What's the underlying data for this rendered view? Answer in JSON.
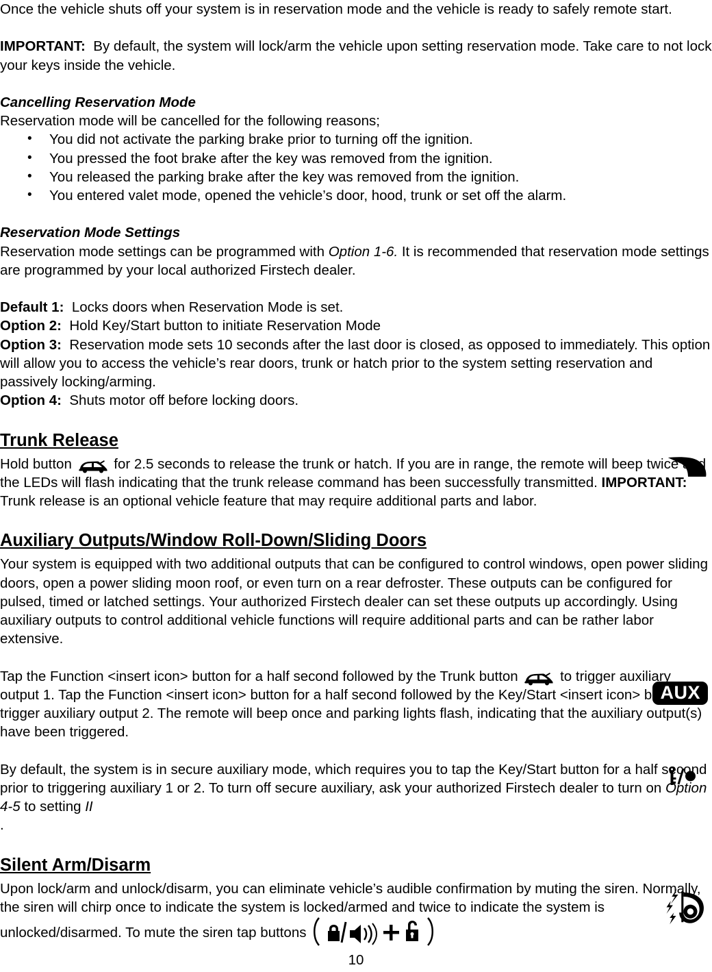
{
  "document": {
    "page_number": "10"
  },
  "intro": {
    "paragraph": "Once the vehicle shuts off your system is in reservation mode and the vehicle is ready to safely remote start.",
    "important_label": "IMPORTANT:",
    "important_text": "By default, the system will lock/arm the vehicle upon setting reservation mode. Take care to not lock your keys inside the vehicle."
  },
  "cancelling": {
    "heading": "Cancelling Reservation Mode",
    "lead_in": "Reservation mode will be cancelled for the following reasons;",
    "reasons": [
      "You did not activate the parking brake prior to turning off the ignition.",
      "You pressed the foot brake after the key was removed from the ignition.",
      "You released the parking brake after the key was removed from the ignition.",
      "You entered valet mode, opened the vehicle’s door, hood, trunk or set off the alarm."
    ]
  },
  "settings": {
    "heading": "Reservation Mode Settings",
    "intro_part1": "Reservation mode settings can be programmed with ",
    "intro_option": "Option 1-6.",
    "intro_part2": "  It is recommended that reservation mode settings are programmed by your local authorized Firstech dealer.",
    "options": [
      {
        "label": "Default 1:",
        "text": "Locks doors when Reservation Mode is set."
      },
      {
        "label": "Option 2:",
        "text": "Hold Key/Start button to initiate Reservation Mode"
      },
      {
        "label": "Option 3:",
        "text": "Reservation mode sets 10 seconds after the last door is closed, as opposed to immediately. This option will allow you to access the vehicle’s rear doors, trunk or hatch prior to the system setting reservation and passively locking/arming."
      },
      {
        "label": "Option 4:",
        "text": "Shuts motor off before locking doors."
      }
    ]
  },
  "trunk_release": {
    "heading": "Trunk Release",
    "text_part1": "Hold button ",
    "icon_name": "trunk-hatch-icon",
    "text_part2": " for 2.5 seconds to release the trunk or hatch. If you are in range, the remote will beep twice and the LEDs will flash indicating that the trunk release command has been successfully transmitted. ",
    "important_label": "IMPORTANT:",
    "text_part3": " Trunk release is an optional vehicle feature that may require additional parts and labor.",
    "margin_icon_name": "trunk-hatch-icon-large"
  },
  "auxiliary": {
    "heading": "Auxiliary Outputs/Window Roll-Down/Sliding Doors",
    "paragraph1": "Your system is equipped with two additional outputs that can be configured to control windows, open power sliding doors, open a power sliding moon roof, or even turn on a rear defroster. These outputs can be configured for pulsed, timed or latched settings. Your authorized Firstech dealer can set these outputs up accordingly. Using auxiliary outputs to control additional vehicle functions will require additional parts and can be rather labor extensive.",
    "paragraph2_part1": "Tap the Function <insert icon> button for a half second followed by the Trunk button ",
    "paragraph2_part2": " to trigger auxiliary output 1. Tap the Function <insert icon> button for a half second followed by the Key/Start <insert icon> button to trigger auxiliary output 2. The remote will beep once and parking lights flash, indicating that the auxiliary output(s) have been triggered.",
    "aux_badge_label": "AUX",
    "paragraph3_part1": "By default, the system is in secure auxiliary mode, which requires you to tap the Key/Start button ",
    "paragraph3_part2": " for a half second prior to triggering auxiliary 1 or 2. To turn off secure auxiliary, ask your authorized Firstech dealer to turn on ",
    "paragraph3_option": "Option 4-5",
    "paragraph3_part3": " to setting ",
    "paragraph3_setting": "II",
    "stray_period": ".",
    "key_icon_name": "key-start-icon"
  },
  "silent": {
    "heading": "Silent Arm/Disarm",
    "paragraph_part1": "Upon lock/arm and unlock/disarm, you can eliminate vehicle’s audible confirmation by muting the siren. Normally, the siren will chirp once to indicate the system is locked/armed and twice to indicate the system is unlocked/disarmed. To mute the siren tap buttons ",
    "button_combo_name": "lock-sound-plus-unlock-icon",
    "margin_icon_name": "siren-muted-icon"
  },
  "colors": {
    "text": "#000000",
    "background": "#ffffff",
    "badge_background": "#000000",
    "badge_text": "#ffffff"
  }
}
